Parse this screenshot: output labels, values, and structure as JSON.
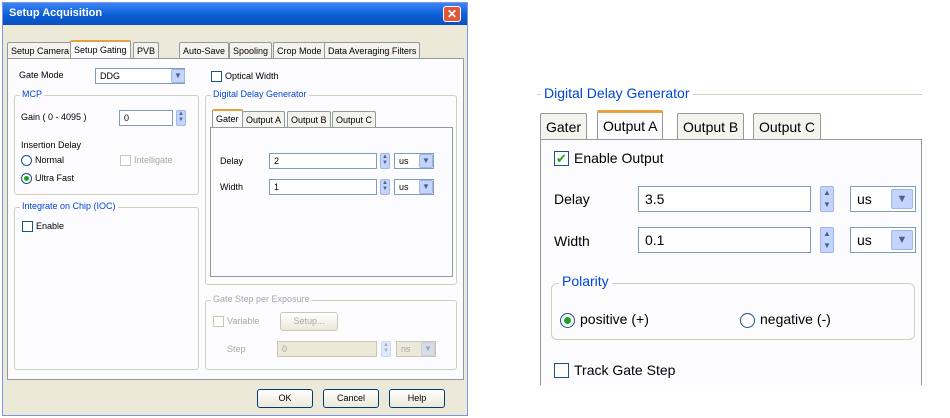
{
  "dialog": {
    "title": "Setup Acquisition",
    "close_glyph": "✕",
    "tabs": [
      {
        "label": "Setup Camera"
      },
      {
        "label": "Setup Gating"
      },
      {
        "label": "PVB"
      },
      {
        "label": "Auto-Save"
      },
      {
        "label": "Spooling"
      },
      {
        "label": "Crop Mode"
      },
      {
        "label": "Data Averaging Filters"
      }
    ],
    "active_tab": "Setup Gating",
    "gate_mode": {
      "label": "Gate Mode",
      "value": "DDG"
    },
    "optical_width": {
      "label": "Optical Width",
      "checked": false
    },
    "mcp": {
      "title": "MCP",
      "gain_label": "Gain ( 0 - 4095 )",
      "gain_value": "0",
      "insertion_delay_label": "Insertion Delay",
      "normal_label": "Normal",
      "ultra_fast_label": "Ultra Fast",
      "selected": "Ultra Fast",
      "intelligate_label": "Intelligate"
    },
    "ioc": {
      "title": "Integrate on Chip (IOC)",
      "enable_label": "Enable",
      "enabled": false
    },
    "ddg": {
      "title": "Digital Delay Generator",
      "tabs": [
        {
          "label": "Gater"
        },
        {
          "label": "Output A"
        },
        {
          "label": "Output B"
        },
        {
          "label": "Output C"
        }
      ],
      "active_tab": "Gater",
      "delay_label": "Delay",
      "delay_value": "2",
      "delay_unit": "us",
      "width_label": "Width",
      "width_value": "1",
      "width_unit": "us"
    },
    "gate_step": {
      "title": "Gate Step per Exposure",
      "variable_label": "Variable",
      "setup_label": "Setup...",
      "step_label": "Step",
      "step_value": "0",
      "step_unit": "ns"
    },
    "buttons": {
      "ok": "OK",
      "cancel": "Cancel",
      "help": "Help"
    }
  },
  "zoom": {
    "title": "Digital Delay Generator",
    "tabs": [
      {
        "label": "Gater"
      },
      {
        "label": "Output A"
      },
      {
        "label": "Output B"
      },
      {
        "label": "Output C"
      }
    ],
    "active_tab": "Output A",
    "enable_output": {
      "label": "Enable Output",
      "checked": true
    },
    "delay_label": "Delay",
    "delay_value": "3.5",
    "delay_unit": "us",
    "width_label": "Width",
    "width_value": "0.1",
    "width_unit": "us",
    "polarity": {
      "title": "Polarity",
      "positive_label": "positive (+)",
      "negative_label": "negative (-)",
      "selected": "positive (+)"
    },
    "track_gate_step": {
      "label": "Track Gate Step",
      "checked": false
    }
  },
  "colors": {
    "titlebar": "#0a5fd4",
    "dialog_bg": "#ece9d8",
    "group_title": "#0046d5",
    "active_tab_accent": "#e6a23c",
    "check_green": "#21a121"
  },
  "icons": {
    "spin": "spin-updown-icon",
    "combo": "chevron-down-icon",
    "close": "close-icon"
  }
}
